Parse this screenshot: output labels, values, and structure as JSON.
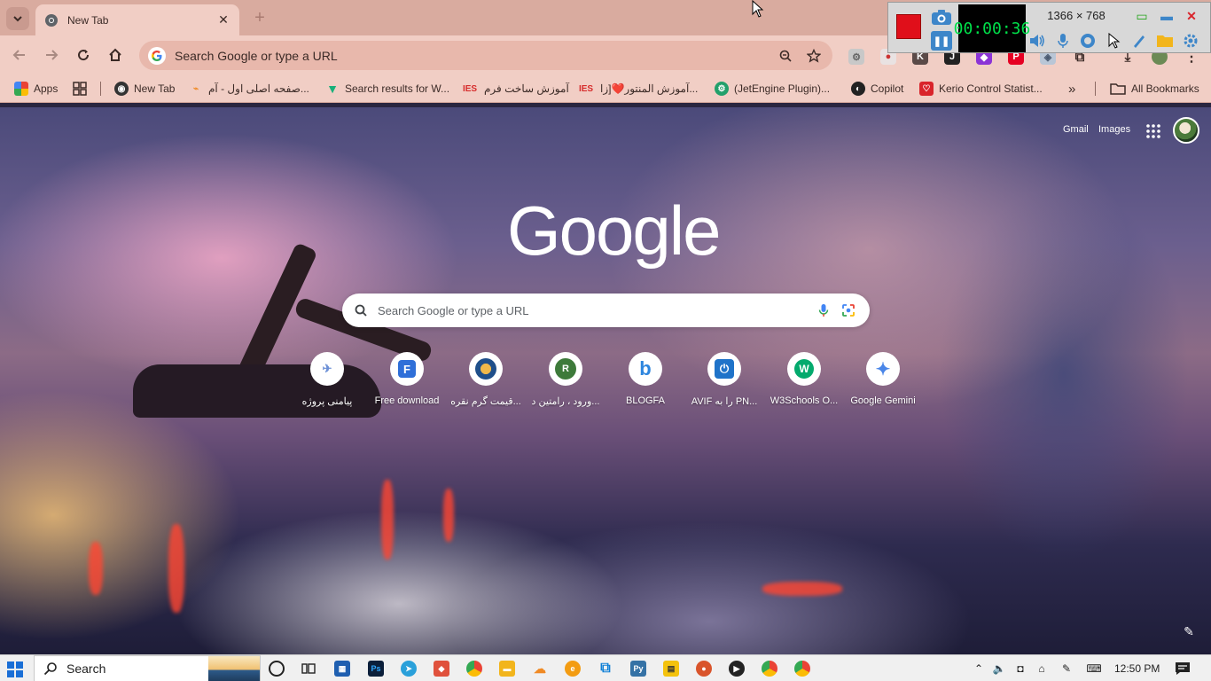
{
  "tab": {
    "title": "New Tab",
    "close": "✕",
    "new_tab": "+"
  },
  "omnibox": {
    "placeholder": "Search Google or type a URL"
  },
  "bookmarks": [
    {
      "label": "Apps",
      "icon": "apps-grid-icon"
    },
    {
      "label": "",
      "icon": "grid-icon"
    },
    {
      "label": "New Tab",
      "icon": "tab-icon"
    },
    {
      "label": "صفحه اصلی اول - آم...",
      "icon": "site-icon"
    },
    {
      "label": "Search results for W...",
      "icon": "v-icon"
    },
    {
      "label": "آموزش ساخت فرم",
      "icon": "ies-icon"
    },
    {
      "label": "آموزش المنتور❤️[زا...",
      "icon": "ies-icon"
    },
    {
      "label": "(JetEngine Plugin)...",
      "icon": "jetengine-icon"
    },
    {
      "label": "Copilot",
      "icon": "copilot-icon"
    },
    {
      "label": "Kerio Control Statist...",
      "icon": "kerio-icon"
    },
    {
      "label": "»",
      "icon": "more-chevron-icon"
    },
    {
      "label": "All Bookmarks",
      "icon": "folder-icon"
    }
  ],
  "ntp": {
    "gmail": "Gmail",
    "images": "Images",
    "logo": "Google",
    "search_placeholder": "Search Google or type a URL",
    "customize": "✎"
  },
  "shortcuts": [
    {
      "label": "پیامنی پروژه",
      "glyph": "✈",
      "color": "#6b8fd6"
    },
    {
      "label": "Free download",
      "glyph": "F",
      "color": "#2f6fd8"
    },
    {
      "label": "قیمت گرم نقره...",
      "glyph": "●",
      "color": "#1f4f8a"
    },
    {
      "label": "ورود ، رامتین د...",
      "glyph": "R",
      "color": "#3d7a3a"
    },
    {
      "label": "BLOGFA",
      "glyph": "b",
      "color": "#2e86de"
    },
    {
      "label": "AVIF را به PN...",
      "glyph": "⏻",
      "color": "#1f73c9"
    },
    {
      "label": "W3Schools O...",
      "glyph": "W",
      "color": "#04aa6d"
    },
    {
      "label": "Google Gemini",
      "glyph": "✦",
      "color": "#4a86e8"
    }
  ],
  "recorder": {
    "timer": "00:00:36",
    "resolution": "1366 × 768"
  },
  "taskbar": {
    "search": "Search",
    "clock": "12:50 PM"
  }
}
